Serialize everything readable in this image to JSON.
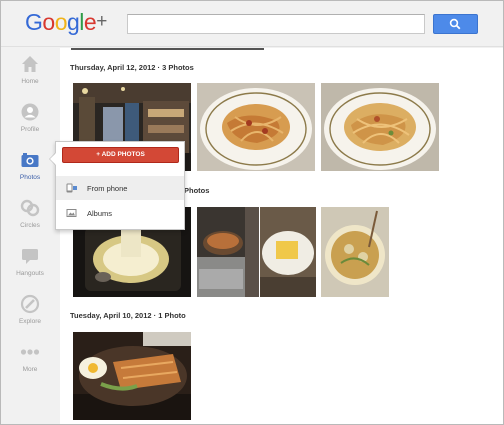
{
  "header": {
    "logo": {
      "google": "Google",
      "plus": "+"
    },
    "search": {
      "value": "",
      "button_icon": "search-icon"
    }
  },
  "nav": {
    "items": [
      {
        "label": "Home",
        "icon": "home-icon",
        "active": false
      },
      {
        "label": "Profile",
        "icon": "profile-icon",
        "active": false
      },
      {
        "label": "Photos",
        "icon": "camera-icon",
        "active": true
      },
      {
        "label": "Circles",
        "icon": "circles-icon",
        "active": false
      },
      {
        "label": "Hangouts",
        "icon": "hangouts-icon",
        "active": false
      },
      {
        "label": "Explore",
        "icon": "explore-icon",
        "active": false
      },
      {
        "label": "More",
        "icon": "more-icon",
        "active": false
      }
    ]
  },
  "main": {
    "days": [
      {
        "date": "Thursday, April 12, 2012",
        "count": "3 Photos"
      },
      {
        "date": "",
        "count": "Photos"
      },
      {
        "date": "Tuesday, April 10, 2012",
        "count": "1 Photo"
      }
    ]
  },
  "flyout": {
    "add_label": "+ ADD PHOTOS",
    "items": [
      {
        "label": "From phone",
        "icon": "phone-icon"
      },
      {
        "label": "Albums",
        "icon": "albums-icon"
      }
    ]
  },
  "colors": {
    "accent_blue": "#4d8ae9",
    "add_red": "#d34836",
    "active_nav": "#3b5ea8"
  }
}
